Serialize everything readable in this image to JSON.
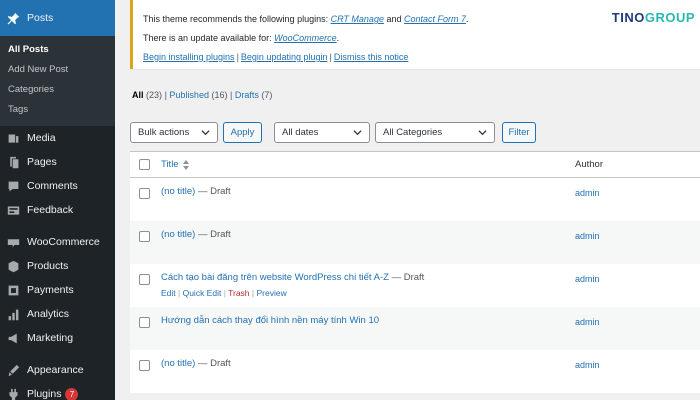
{
  "sidebar": {
    "posts": {
      "label": "Posts",
      "icon": "pushpin-icon"
    },
    "posts_submenu": [
      {
        "label": "All Posts",
        "current": true
      },
      {
        "label": "Add New Post"
      },
      {
        "label": "Categories"
      },
      {
        "label": "Tags"
      }
    ],
    "items": [
      {
        "label": "Media",
        "icon": "media-icon"
      },
      {
        "label": "Pages",
        "icon": "pages-icon"
      },
      {
        "label": "Comments",
        "icon": "comments-icon"
      },
      {
        "label": "Feedback",
        "icon": "feedback-icon"
      },
      {
        "label": "WooCommerce",
        "icon": "woocommerce-icon"
      },
      {
        "label": "Products",
        "icon": "products-icon"
      },
      {
        "label": "Payments",
        "icon": "payments-icon"
      },
      {
        "label": "Analytics",
        "icon": "analytics-icon"
      },
      {
        "label": "Marketing",
        "icon": "marketing-icon"
      },
      {
        "label": "Appearance",
        "icon": "appearance-icon"
      },
      {
        "label": "Plugins",
        "icon": "plugins-icon",
        "badge": "7"
      }
    ]
  },
  "notice": {
    "line1_prefix": "This theme recommends the following plugins: ",
    "plugin1": "CRT Manage",
    "line1_and": " and ",
    "plugin2": "Contact Form 7",
    "line1_suffix": ".",
    "line2_prefix": "There is an update available for: ",
    "plugin3": "WooCommerce",
    "line2_suffix": ".",
    "link_install": "Begin installing plugins",
    "link_update": "Begin updating plugin",
    "link_dismiss": "Dismiss this notice",
    "separator": "|"
  },
  "logo": {
    "part1": "TINO",
    "part2": "GROUP"
  },
  "filters": {
    "all_label": "All",
    "all_count": "(23)",
    "published_label": "Published",
    "published_count": "(16)",
    "drafts_label": "Drafts",
    "drafts_count": "(7)",
    "separator": "|"
  },
  "tablenav": {
    "bulk_actions": "Bulk actions",
    "apply": "Apply",
    "dates": "All dates",
    "categories": "All Categories",
    "filter": "Filter"
  },
  "table": {
    "col_title": "Title",
    "col_author": "Author",
    "rows": [
      {
        "title": "(no title)",
        "state": " — Draft",
        "author": "admin"
      },
      {
        "title": "(no title)",
        "state": " — Draft",
        "author": "admin"
      },
      {
        "title": "Cách tạo bài đăng trên website WordPress chi tiết A-Z",
        "state": " — Draft",
        "author": "admin",
        "actions": {
          "edit": "Edit",
          "quick_edit": "Quick Edit",
          "trash": "Trash",
          "preview": "Preview",
          "sep": " | "
        }
      },
      {
        "title": "Hướng dẫn cách thay đổi hình nền máy tính Win 10",
        "state": "",
        "author": "admin"
      },
      {
        "title": "(no title)",
        "state": " — Draft",
        "author": "admin"
      }
    ]
  },
  "colors": {
    "sidebar_bg": "#1d2327",
    "accent": "#2271b1",
    "notice_border": "#dba617",
    "badge": "#d63638"
  }
}
